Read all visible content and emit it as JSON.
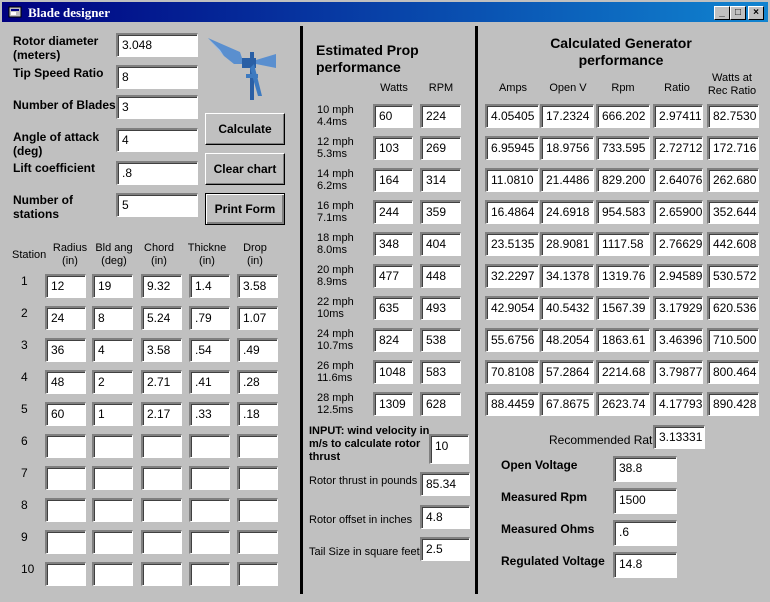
{
  "window": {
    "title": "Blade designer",
    "minimize": "_",
    "maximize": "□",
    "close": "×"
  },
  "inputs": {
    "rotor_diameter": {
      "label": "Rotor diameter (meters)",
      "value": "3.048"
    },
    "tip_speed_ratio": {
      "label": "Tip Speed Ratio",
      "value": "8"
    },
    "number_of_blades": {
      "label": "Number of Blades",
      "value": "3"
    },
    "angle_of_attack": {
      "label": "Angle of attack (deg)",
      "value": "4"
    },
    "lift_coefficient": {
      "label": "Lift coefficient",
      "value": ".8"
    },
    "number_of_stations": {
      "label": "Number of stations",
      "value": "5"
    }
  },
  "buttons": {
    "calculate": "Calculate",
    "clear_chart": "Clear chart",
    "print_form": "Print Form"
  },
  "stations": {
    "headers": {
      "station": "Station",
      "radius": "Radius (in)",
      "bld_ang": "Bld ang (deg)",
      "chord": "Chord (in)",
      "thickness": "Thickne (in)",
      "drop": "Drop (in)"
    },
    "rows": [
      {
        "num": "1",
        "radius": "12",
        "bld_ang": "19",
        "chord": "9.32",
        "thick": "1.4",
        "drop": "3.58"
      },
      {
        "num": "2",
        "radius": "24",
        "bld_ang": "8",
        "chord": "5.24",
        "thick": ".79",
        "drop": "1.07"
      },
      {
        "num": "3",
        "radius": "36",
        "bld_ang": "4",
        "chord": "3.58",
        "thick": ".54",
        "drop": ".49"
      },
      {
        "num": "4",
        "radius": "48",
        "bld_ang": "2",
        "chord": "2.71",
        "thick": ".41",
        "drop": ".28"
      },
      {
        "num": "5",
        "radius": "60",
        "bld_ang": "1",
        "chord": "2.17",
        "thick": ".33",
        "drop": ".18"
      },
      {
        "num": "6",
        "radius": "",
        "bld_ang": "",
        "chord": "",
        "thick": "",
        "drop": ""
      },
      {
        "num": "7",
        "radius": "",
        "bld_ang": "",
        "chord": "",
        "thick": "",
        "drop": ""
      },
      {
        "num": "8",
        "radius": "",
        "bld_ang": "",
        "chord": "",
        "thick": "",
        "drop": ""
      },
      {
        "num": "9",
        "radius": "",
        "bld_ang": "",
        "chord": "",
        "thick": "",
        "drop": ""
      },
      {
        "num": "10",
        "radius": "",
        "bld_ang": "",
        "chord": "",
        "thick": "",
        "drop": ""
      }
    ]
  },
  "prop": {
    "title": "Estimated Prop performance",
    "col_watts": "Watts",
    "col_rpm": "RPM",
    "rows": [
      {
        "mph": "10 mph",
        "ms": "4.4ms",
        "watts": "60",
        "rpm": "224"
      },
      {
        "mph": "12 mph",
        "ms": "5.3ms",
        "watts": "103",
        "rpm": "269"
      },
      {
        "mph": "14 mph",
        "ms": "6.2ms",
        "watts": "164",
        "rpm": "314"
      },
      {
        "mph": "16 mph",
        "ms": "7.1ms",
        "watts": "244",
        "rpm": "359"
      },
      {
        "mph": "18 mph",
        "ms": "8.0ms",
        "watts": "348",
        "rpm": "404"
      },
      {
        "mph": "20 mph",
        "ms": "8.9ms",
        "watts": "477",
        "rpm": "448"
      },
      {
        "mph": "22 mph",
        "ms": "10ms",
        "watts": "635",
        "rpm": "493"
      },
      {
        "mph": "24 mph",
        "ms": "10.7ms",
        "watts": "824",
        "rpm": "538"
      },
      {
        "mph": "26 mph",
        "ms": "11.6ms",
        "watts": "1048",
        "rpm": "583"
      },
      {
        "mph": "28 mph",
        "ms": "12.5ms",
        "watts": "1309",
        "rpm": "628"
      }
    ],
    "thrust_input_label": "INPUT: wind velocity in m/s to calculate rotor thrust",
    "thrust_input_value": "10",
    "rotor_thrust_label": "Rotor thrust in pounds",
    "rotor_thrust_value": "85.34",
    "rotor_offset_label": "Rotor offset in inches",
    "rotor_offset_value": "4.8",
    "tail_size_label": "Tail Size in square feet",
    "tail_size_value": "2.5"
  },
  "generator": {
    "title": "Calculated Generator performance",
    "col_amps": "Amps",
    "col_openv": "Open V",
    "col_rpm": "Rpm",
    "col_ratio": "Ratio",
    "col_watts": "Watts at Rec Ratio",
    "rows": [
      {
        "amps": "4.05405",
        "openv": "17.2324",
        "rpm": "666.202",
        "ratio": "2.97411",
        "watts": "82.7530"
      },
      {
        "amps": "6.95945",
        "openv": "18.9756",
        "rpm": "733.595",
        "ratio": "2.72712",
        "watts": "172.716"
      },
      {
        "amps": "11.0810",
        "openv": "21.4486",
        "rpm": "829.200",
        "ratio": "2.64076",
        "watts": "262.680"
      },
      {
        "amps": "16.4864",
        "openv": "24.6918",
        "rpm": "954.583",
        "ratio": "2.65900",
        "watts": "352.644"
      },
      {
        "amps": "23.5135",
        "openv": "28.9081",
        "rpm": "1117.58",
        "ratio": "2.76629",
        "watts": "442.608"
      },
      {
        "amps": "32.2297",
        "openv": "34.1378",
        "rpm": "1319.76",
        "ratio": "2.94589",
        "watts": "530.572"
      },
      {
        "amps": "42.9054",
        "openv": "40.5432",
        "rpm": "1567.39",
        "ratio": "3.17929",
        "watts": "620.536"
      },
      {
        "amps": "55.6756",
        "openv": "48.2054",
        "rpm": "1863.61",
        "ratio": "3.46396",
        "watts": "710.500"
      },
      {
        "amps": "70.8108",
        "openv": "57.2864",
        "rpm": "2214.68",
        "ratio": "3.79877",
        "watts": "800.464"
      },
      {
        "amps": "88.4459",
        "openv": "67.8675",
        "rpm": "2623.74",
        "ratio": "4.17793",
        "watts": "890.428"
      }
    ],
    "recommended_ratio_label": "Recommended Ratio",
    "recommended_ratio_value": "3.13331",
    "open_voltage_label": "Open Voltage",
    "open_voltage_value": "38.8",
    "measured_rpm_label": "Measured Rpm",
    "measured_rpm_value": "1500",
    "measured_ohms_label": "Measured Ohms",
    "measured_ohms_value": ".6",
    "regulated_voltage_label": "Regulated Voltage",
    "regulated_voltage_value": "14.8"
  },
  "colors": {
    "title_gradient_start": "#000080",
    "title_gradient_end": "#1084d0",
    "face": "#c0c0c0"
  }
}
